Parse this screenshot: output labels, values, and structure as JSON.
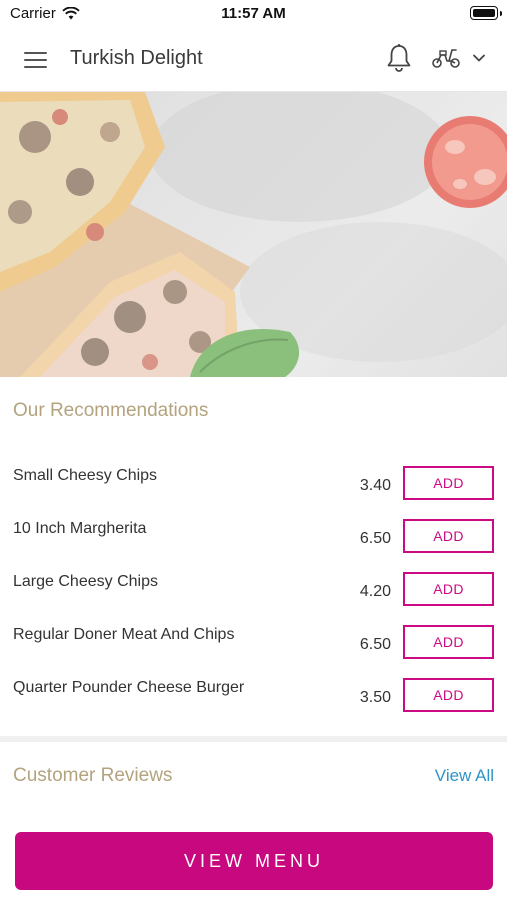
{
  "status_bar": {
    "carrier": "Carrier",
    "time": "11:57 AM"
  },
  "header": {
    "title": "Turkish Delight",
    "icons": [
      "menu-icon",
      "bell-icon",
      "scooter-icon",
      "chevron-down-icon"
    ]
  },
  "recommendations": {
    "title": "Our Recommendations",
    "items": [
      {
        "name": "Small Cheesy Chips",
        "price": "3.40",
        "button": "ADD"
      },
      {
        "name": "10 Inch Margherita",
        "price": "6.50",
        "button": "ADD"
      },
      {
        "name": "Large Cheesy Chips",
        "price": "4.20",
        "button": "ADD"
      },
      {
        "name": "Regular Doner Meat And Chips",
        "price": "6.50",
        "button": "ADD"
      },
      {
        "name": "Quarter Pounder Cheese Burger",
        "price": "3.50",
        "button": "ADD"
      }
    ]
  },
  "reviews": {
    "title": "Customer Reviews",
    "view_all": "View All"
  },
  "footer": {
    "view_menu": "VIEW MENU"
  },
  "colors": {
    "accent": "#c8087e",
    "section_title": "#b3a37e",
    "link": "#2f93c7"
  }
}
